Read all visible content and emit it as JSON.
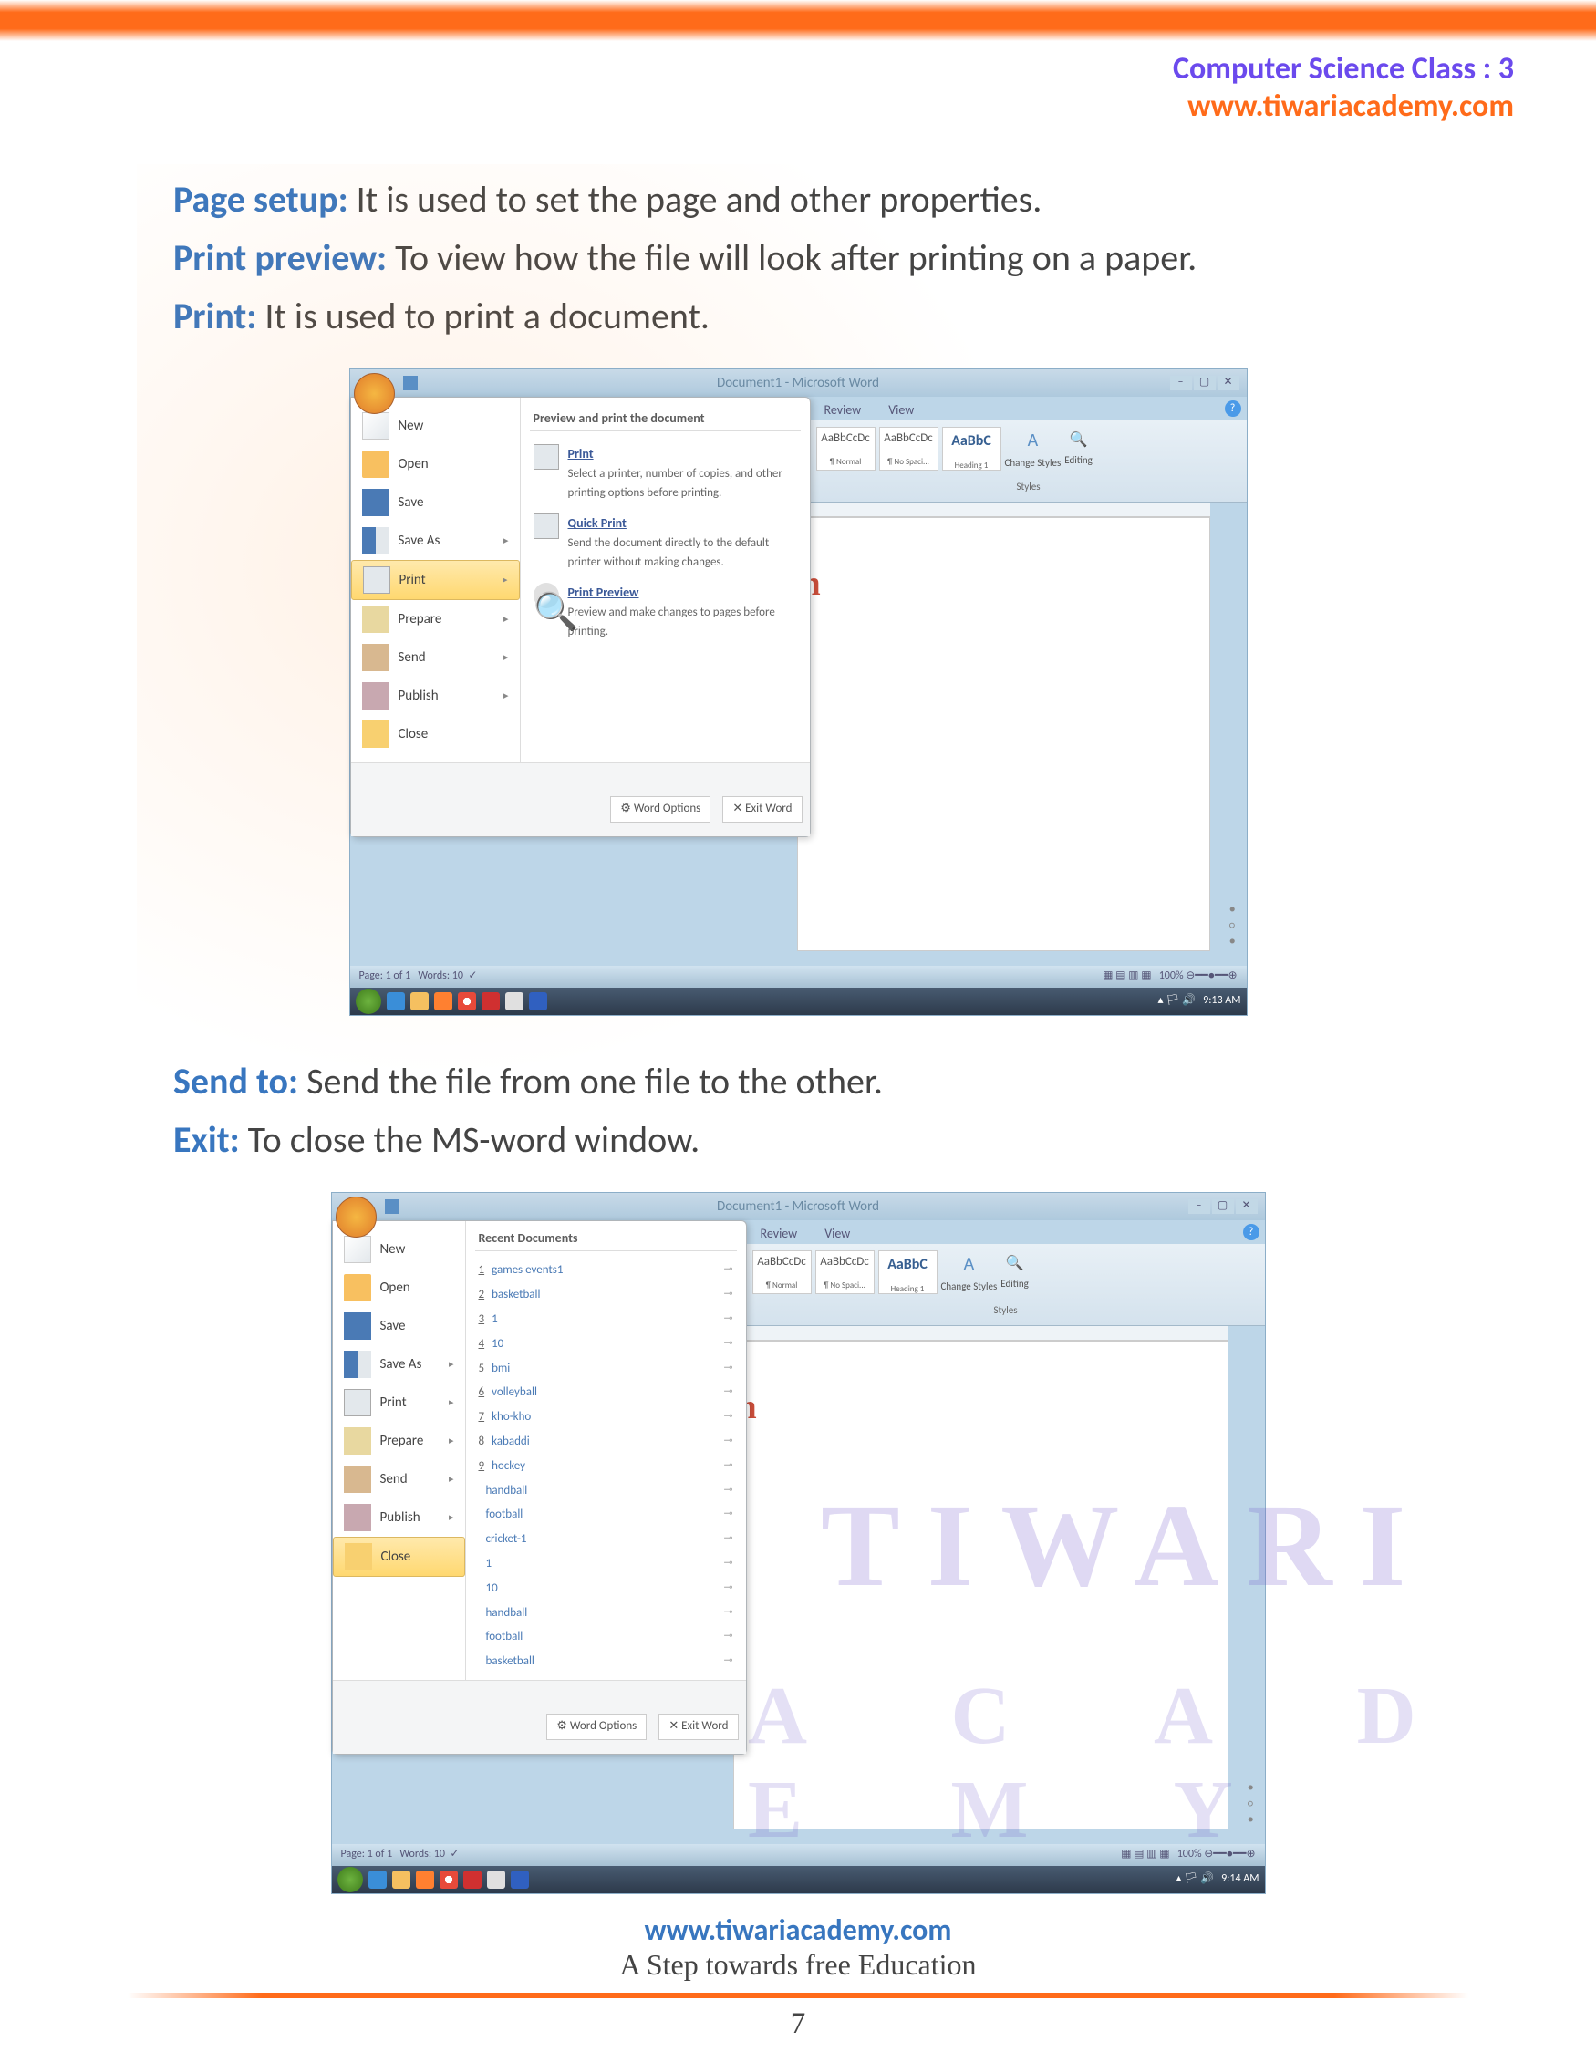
{
  "header": {
    "line1": "Computer Science Class : 3",
    "line2": "www.tiwariacademy.com"
  },
  "content": {
    "page_setup_label": "Page setup:",
    "page_setup_text": " It is used to set the page and other properties.",
    "print_preview_label": "Print preview:",
    "print_preview_text": " To view how the file will look after printing on a paper.",
    "print_label": "Print:",
    "print_text": " It is used to print a document.",
    "send_label": "Send to:",
    "send_text": " Send the file from one file to the other.",
    "exit_label": "Exit:",
    "exit_text": " To close the MS-word window."
  },
  "word": {
    "title": "Document1 - Microsoft Word",
    "tabs": {
      "review": "Review",
      "view": "View"
    },
    "help": "?",
    "menu_items": {
      "new": "New",
      "open": "Open",
      "save": "Save",
      "saveas": "Save As",
      "print": "Print",
      "prepare": "Prepare",
      "send": "Send",
      "publish": "Publish",
      "close": "Close"
    },
    "preview_header": "Preview and print the document",
    "recent_header": "Recent Documents",
    "submenu": {
      "print": {
        "title": "Print",
        "desc": "Select a printer, number of copies, and other printing options before printing."
      },
      "quick": {
        "title": "Quick Print",
        "desc": "Send the document directly to the default printer without making changes."
      },
      "preview": {
        "title": "Print Preview",
        "desc": "Preview and make changes to pages before printing."
      }
    },
    "recent_docs": [
      {
        "n": "1",
        "t": "games events1"
      },
      {
        "n": "2",
        "t": "basketball"
      },
      {
        "n": "3",
        "t": "1"
      },
      {
        "n": "4",
        "t": "10"
      },
      {
        "n": "5",
        "t": "bmi"
      },
      {
        "n": "6",
        "t": "volleyball"
      },
      {
        "n": "7",
        "t": "kho-kho"
      },
      {
        "n": "8",
        "t": "kabaddi"
      },
      {
        "n": "9",
        "t": "hockey"
      },
      {
        "n": "",
        "t": "handball"
      },
      {
        "n": "",
        "t": "football"
      },
      {
        "n": "",
        "t": "cricket-1"
      },
      {
        "n": "",
        "t": "1"
      },
      {
        "n": "",
        "t": "10"
      },
      {
        "n": "",
        "t": "handball"
      },
      {
        "n": "",
        "t": "football"
      },
      {
        "n": "",
        "t": "basketball"
      }
    ],
    "footer_btns": {
      "options": "Word Options",
      "exit": "Exit Word"
    },
    "doc_text": "h",
    "doc_text2": "h",
    "styles": {
      "s1_sample": "AaBbCcDc",
      "s1_name": "¶ Normal",
      "s2_sample": "AaBbCcDc",
      "s2_name": "¶ No Spaci...",
      "s3_sample": "AaBbC",
      "s3_name": "Heading 1",
      "change": "Change Styles",
      "editing": "Editing",
      "label": "Styles"
    },
    "status": {
      "page": "Page: 1 of 1",
      "words": "Words: 10",
      "zoom": "100%"
    },
    "tray_time1": "9:13 AM",
    "tray_time2": "9:14 AM"
  },
  "watermark": {
    "w1": "TIWARI",
    "w2": "A  C  A  D  E  M  Y"
  },
  "footer": {
    "url": "www.tiwariacademy.com",
    "tag": "A Step towards free Education",
    "page": "7"
  },
  "icons": {
    "pin": "📌",
    "x": "✕"
  }
}
